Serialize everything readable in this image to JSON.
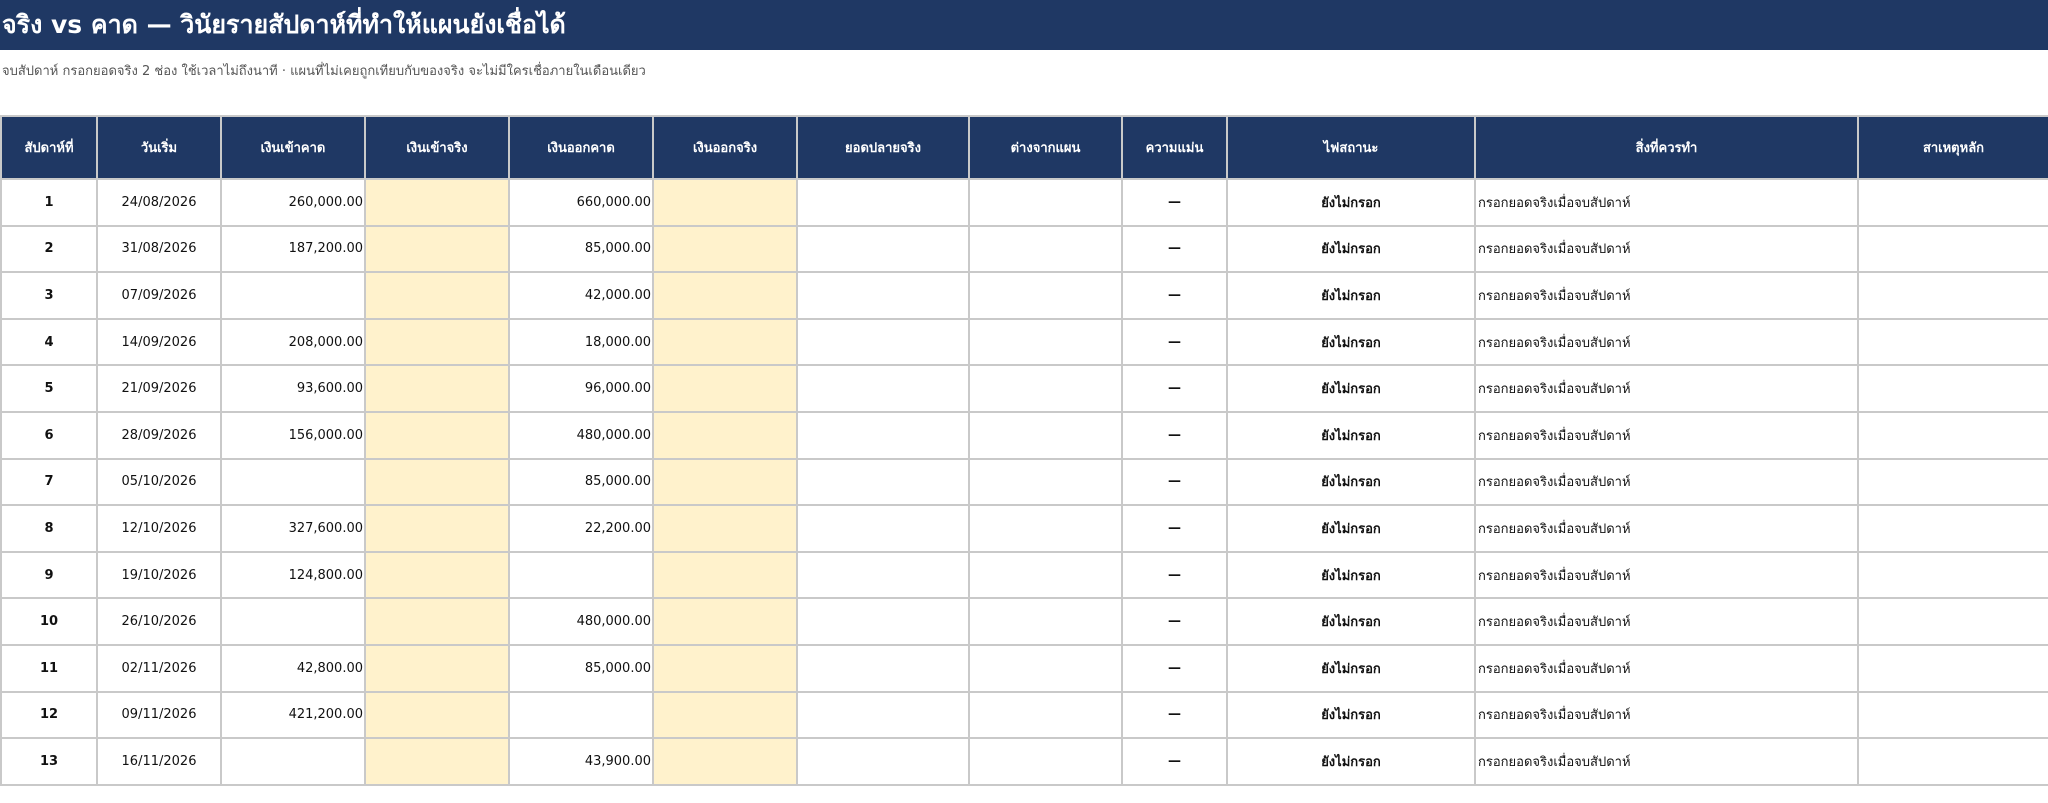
{
  "title": "จริง vs คาด — วินัยรายสัปดาห์ที่ทำให้แผนยังเชื่อได้",
  "subtitle": "จบสัปดาห์ กรอกยอดจริง 2 ช่อง ใช้เวลาไม่ถึงนาที · แผนที่ไม่เคยถูกเทียบกับของจริง จะไม่มีใครเชื่อภายในเดือนเดียว",
  "colors": {
    "header_bg": "#1f3864",
    "input_fill": "#fff2cc",
    "grid": "#c9c9c9"
  },
  "columns": [
    "สัปดาห์ที่",
    "วันเริ่ม",
    "เงินเข้าคาด",
    "เงินเข้าจริง",
    "เงินออกคาด",
    "เงินออกจริง",
    "ยอดปลายจริง",
    "ต่างจากแผน",
    "ความแม่น",
    "ไฟสถานะ",
    "สิ่งที่ควรทำ",
    "สาเหตุหลัก"
  ],
  "rows": [
    {
      "week": "1",
      "start": "24/08/2026",
      "in_exp": "260,000.00",
      "in_act": "",
      "out_exp": "660,000.00",
      "out_act": "",
      "end_act": "",
      "diff": "",
      "acc": "—",
      "status": "ยังไม่กรอก",
      "action": "กรอกยอดจริงเมื่อจบสัปดาห์",
      "cause": ""
    },
    {
      "week": "2",
      "start": "31/08/2026",
      "in_exp": "187,200.00",
      "in_act": "",
      "out_exp": "85,000.00",
      "out_act": "",
      "end_act": "",
      "diff": "",
      "acc": "—",
      "status": "ยังไม่กรอก",
      "action": "กรอกยอดจริงเมื่อจบสัปดาห์",
      "cause": ""
    },
    {
      "week": "3",
      "start": "07/09/2026",
      "in_exp": "",
      "in_act": "",
      "out_exp": "42,000.00",
      "out_act": "",
      "end_act": "",
      "diff": "",
      "acc": "—",
      "status": "ยังไม่กรอก",
      "action": "กรอกยอดจริงเมื่อจบสัปดาห์",
      "cause": ""
    },
    {
      "week": "4",
      "start": "14/09/2026",
      "in_exp": "208,000.00",
      "in_act": "",
      "out_exp": "18,000.00",
      "out_act": "",
      "end_act": "",
      "diff": "",
      "acc": "—",
      "status": "ยังไม่กรอก",
      "action": "กรอกยอดจริงเมื่อจบสัปดาห์",
      "cause": ""
    },
    {
      "week": "5",
      "start": "21/09/2026",
      "in_exp": "93,600.00",
      "in_act": "",
      "out_exp": "96,000.00",
      "out_act": "",
      "end_act": "",
      "diff": "",
      "acc": "—",
      "status": "ยังไม่กรอก",
      "action": "กรอกยอดจริงเมื่อจบสัปดาห์",
      "cause": ""
    },
    {
      "week": "6",
      "start": "28/09/2026",
      "in_exp": "156,000.00",
      "in_act": "",
      "out_exp": "480,000.00",
      "out_act": "",
      "end_act": "",
      "diff": "",
      "acc": "—",
      "status": "ยังไม่กรอก",
      "action": "กรอกยอดจริงเมื่อจบสัปดาห์",
      "cause": ""
    },
    {
      "week": "7",
      "start": "05/10/2026",
      "in_exp": "",
      "in_act": "",
      "out_exp": "85,000.00",
      "out_act": "",
      "end_act": "",
      "diff": "",
      "acc": "—",
      "status": "ยังไม่กรอก",
      "action": "กรอกยอดจริงเมื่อจบสัปดาห์",
      "cause": ""
    },
    {
      "week": "8",
      "start": "12/10/2026",
      "in_exp": "327,600.00",
      "in_act": "",
      "out_exp": "22,200.00",
      "out_act": "",
      "end_act": "",
      "diff": "",
      "acc": "—",
      "status": "ยังไม่กรอก",
      "action": "กรอกยอดจริงเมื่อจบสัปดาห์",
      "cause": ""
    },
    {
      "week": "9",
      "start": "19/10/2026",
      "in_exp": "124,800.00",
      "in_act": "",
      "out_exp": "",
      "out_act": "",
      "end_act": "",
      "diff": "",
      "acc": "—",
      "status": "ยังไม่กรอก",
      "action": "กรอกยอดจริงเมื่อจบสัปดาห์",
      "cause": ""
    },
    {
      "week": "10",
      "start": "26/10/2026",
      "in_exp": "",
      "in_act": "",
      "out_exp": "480,000.00",
      "out_act": "",
      "end_act": "",
      "diff": "",
      "acc": "—",
      "status": "ยังไม่กรอก",
      "action": "กรอกยอดจริงเมื่อจบสัปดาห์",
      "cause": ""
    },
    {
      "week": "11",
      "start": "02/11/2026",
      "in_exp": "42,800.00",
      "in_act": "",
      "out_exp": "85,000.00",
      "out_act": "",
      "end_act": "",
      "diff": "",
      "acc": "—",
      "status": "ยังไม่กรอก",
      "action": "กรอกยอดจริงเมื่อจบสัปดาห์",
      "cause": ""
    },
    {
      "week": "12",
      "start": "09/11/2026",
      "in_exp": "421,200.00",
      "in_act": "",
      "out_exp": "",
      "out_act": "",
      "end_act": "",
      "diff": "",
      "acc": "—",
      "status": "ยังไม่กรอก",
      "action": "กรอกยอดจริงเมื่อจบสัปดาห์",
      "cause": ""
    },
    {
      "week": "13",
      "start": "16/11/2026",
      "in_exp": "",
      "in_act": "",
      "out_exp": "43,900.00",
      "out_act": "",
      "end_act": "",
      "diff": "",
      "acc": "—",
      "status": "ยังไม่กรอก",
      "action": "กรอกยอดจริงเมื่อจบสัปดาห์",
      "cause": ""
    }
  ]
}
